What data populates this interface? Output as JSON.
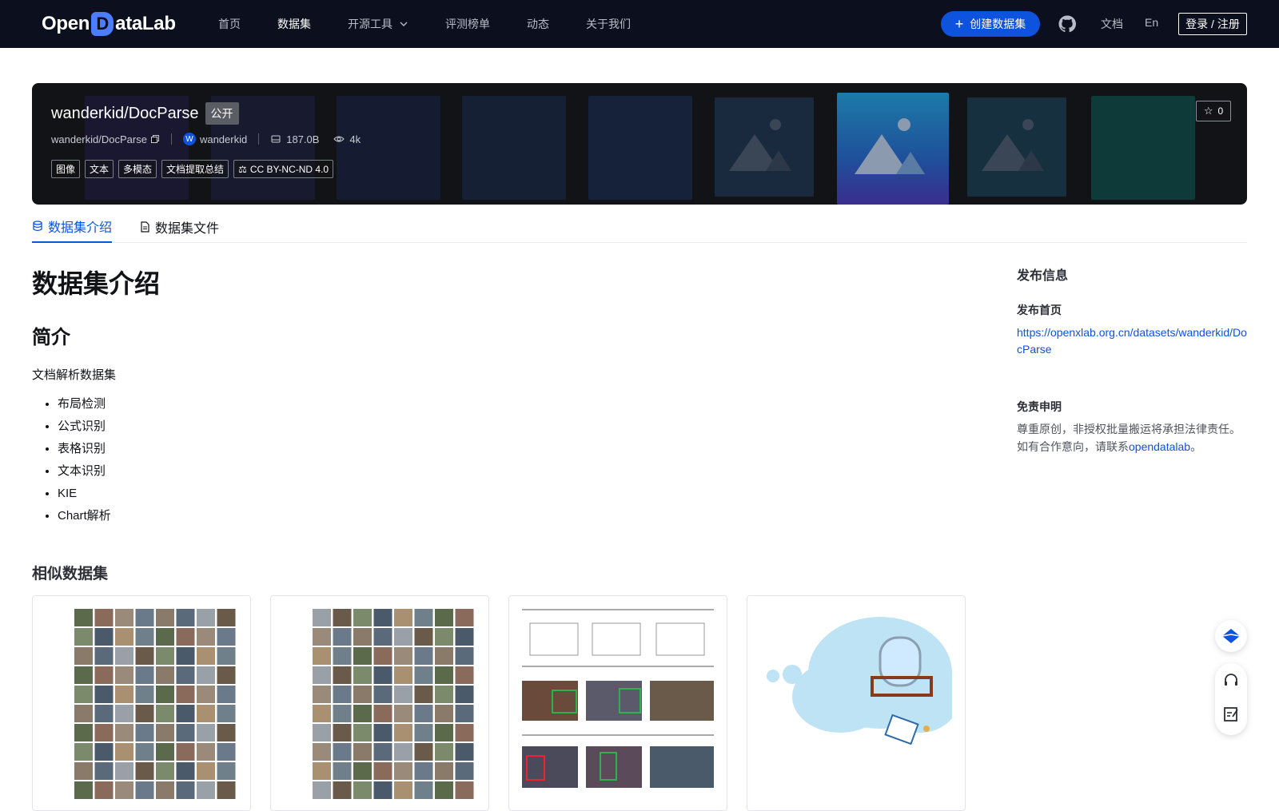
{
  "nav": {
    "logo_text": "OpenDataLab",
    "links": [
      {
        "label": "首页"
      },
      {
        "label": "数据集"
      },
      {
        "label": "开源工具"
      },
      {
        "label": "评测榜单"
      },
      {
        "label": "动态"
      },
      {
        "label": "关于我们"
      }
    ],
    "active_index": 1,
    "create_label": "创建数据集",
    "doc_label": "文档",
    "lang_label": "En",
    "login_label": "登录 / 注册"
  },
  "dataset": {
    "title": "wanderkid/DocParse",
    "visibility": "公开",
    "repo_id": "wanderkid/DocParse",
    "owner_initial": "W",
    "owner": "wanderkid",
    "size": "187.0B",
    "views": "4k",
    "tags": [
      "图像",
      "文本",
      "多模态",
      "文档提取总结"
    ],
    "license": "CC BY-NC-ND 4.0",
    "stars": "0"
  },
  "tabs": [
    {
      "label": "数据集介绍",
      "icon": "database-icon"
    },
    {
      "label": "数据集文件",
      "icon": "file-icon"
    }
  ],
  "content": {
    "heading": "数据集介绍",
    "subheading": "简介",
    "paragraph": "文档解析数据集",
    "items": [
      "布局检测",
      "公式识别",
      "表格识别",
      "文本识别",
      "KIE",
      "Chart解析"
    ]
  },
  "similar": {
    "title": "相似数据集"
  },
  "sidebar": {
    "heading": "发布信息",
    "homepage_label": "发布首页",
    "homepage_url": "https://openxlab.org.cn/datasets/wanderkid/DocParse",
    "disclaimer_label": "免责申明",
    "disclaimer_text": "尊重原创，非授权批量搬运将承担法律责任。如有合作意向，请联系",
    "disclaimer_link": "opendatalab",
    "disclaimer_end": "。"
  },
  "colors": {
    "nav_bg": "#0c0f1d",
    "brand_blue": "#0d53de",
    "hero_bg": "#121316"
  }
}
